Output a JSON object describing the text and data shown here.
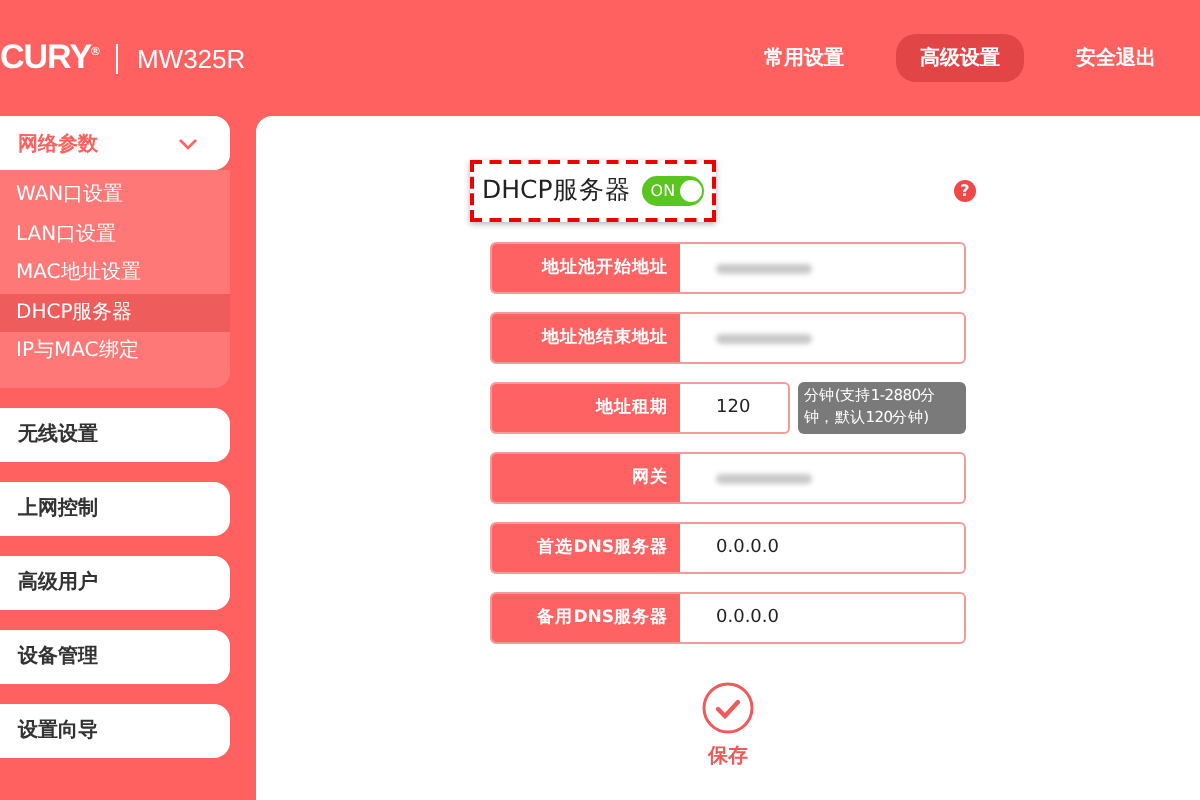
{
  "header": {
    "logo": "CURY$^{®}$",
    "model": "MW325R",
    "nav": [
      {
        "label": "常用设置",
        "selected": false
      },
      {
        "label": "高级设置",
        "selected": true
      },
      {
        "label": "安全退出",
        "selected": false
      }
    ]
  },
  "sidebar": {
    "items": [
      {
        "label": "网络参数",
        "expanded": true,
        "children": [
          {
            "label": "WAN口设置",
            "selected": false
          },
          {
            "label": "LAN口设置",
            "selected": false
          },
          {
            "label": "MAC地址设置",
            "selected": false
          },
          {
            "label": "DHCP服务器",
            "selected": true
          },
          {
            "label": "IP与MAC绑定",
            "selected": false
          }
        ]
      },
      {
        "label": "无线设置",
        "expanded": false
      },
      {
        "label": "上网控制",
        "expanded": false
      },
      {
        "label": "高级用户",
        "expanded": false
      },
      {
        "label": "设备管理",
        "expanded": false
      },
      {
        "label": "设置向导",
        "expanded": false
      }
    ]
  },
  "main": {
    "title": "DHCP服务器",
    "toggle": {
      "label": "ON",
      "on": true
    },
    "help": "?",
    "fields": [
      {
        "label": "地址池开始地址",
        "redacted": true
      },
      {
        "label": "地址池结束地址",
        "redacted": true
      },
      {
        "label": "地址租期",
        "value": "120",
        "hint": "分钟(支持1-2880分钟，默认120分钟)"
      },
      {
        "label": "网关",
        "redacted": true
      },
      {
        "label": "首选DNS服务器",
        "value": "0.0.0.0"
      },
      {
        "label": "备用DNS服务器",
        "value": "0.0.0.0"
      }
    ],
    "save": "保存"
  }
}
